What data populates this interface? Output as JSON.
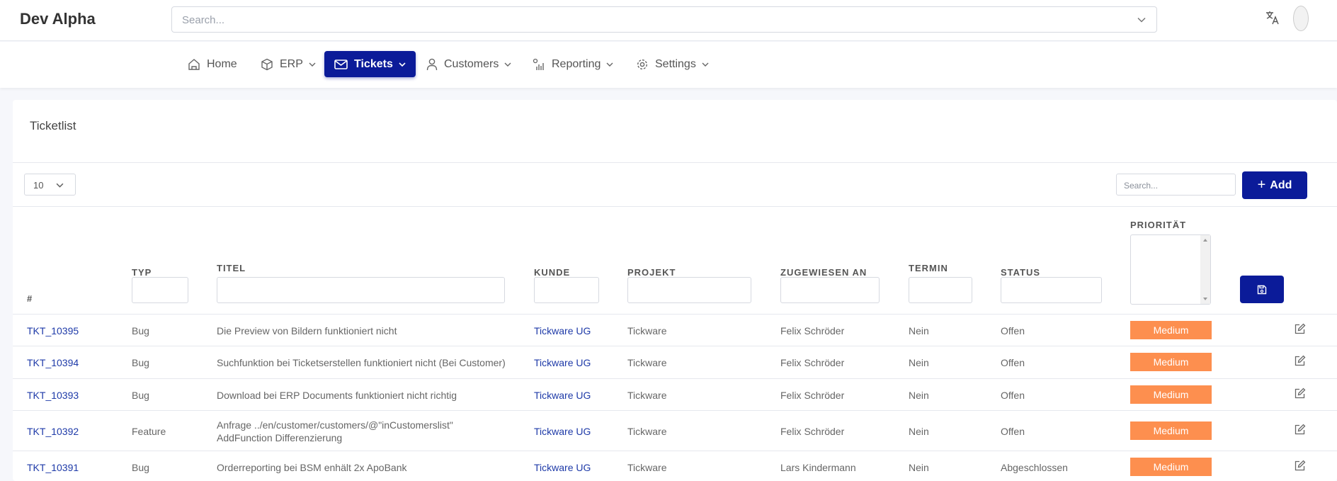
{
  "app": {
    "title": "Dev Alpha"
  },
  "global_search": {
    "placeholder": "Search..."
  },
  "nav": {
    "items": [
      {
        "label": "Home",
        "icon": "home-icon"
      },
      {
        "label": "ERP",
        "icon": "cube-icon"
      },
      {
        "label": "Tickets",
        "icon": "mail-icon",
        "active": true
      },
      {
        "label": "Customers",
        "icon": "user-icon"
      },
      {
        "label": "Reporting",
        "icon": "chart-icon"
      },
      {
        "label": "Settings",
        "icon": "gear-icon"
      }
    ]
  },
  "card": {
    "title": "Ticketlist",
    "page_size": "10",
    "search_placeholder": "Search...",
    "add_label": "Add"
  },
  "table": {
    "columns": [
      "#",
      "TYP",
      "TITEL",
      "KUNDE",
      "PROJEKT",
      "ZUGEWIESEN AN",
      "TERMIN",
      "STATUS",
      "PRIORITÄT"
    ],
    "rows": [
      {
        "id": "TKT_10395",
        "typ": "Bug",
        "titel": "Die Preview von Bildern funktioniert nicht",
        "titel2": "",
        "kunde": "Tickware UG",
        "projekt": "Tickware",
        "zugewiesen": "Felix Schröder",
        "termin": "Nein",
        "status": "Offen",
        "prioritaet": "Medium"
      },
      {
        "id": "TKT_10394",
        "typ": "Bug",
        "titel": "Suchfunktion bei Ticketserstellen funktioniert nicht (Bei Customer)",
        "titel2": "",
        "kunde": "Tickware UG",
        "projekt": "Tickware",
        "zugewiesen": "Felix Schröder",
        "termin": "Nein",
        "status": "Offen",
        "prioritaet": "Medium"
      },
      {
        "id": "TKT_10393",
        "typ": "Bug",
        "titel": "Download bei ERP Documents funktioniert nicht richtig",
        "titel2": "",
        "kunde": "Tickware UG",
        "projekt": "Tickware",
        "zugewiesen": "Felix Schröder",
        "termin": "Nein",
        "status": "Offen",
        "prioritaet": "Medium"
      },
      {
        "id": "TKT_10392",
        "typ": "Feature",
        "titel": "Anfrage ../en/customer/customers/@\"inCustomerslist\"",
        "titel2": "AddFunction Differenzierung",
        "kunde": "Tickware UG",
        "projekt": "Tickware",
        "zugewiesen": "Felix Schröder",
        "termin": "Nein",
        "status": "Offen",
        "prioritaet": "Medium"
      },
      {
        "id": "TKT_10391",
        "typ": "Bug",
        "titel": "Orderreporting bei BSM enhält 2x ApoBank",
        "titel2": "",
        "kunde": "Tickware UG",
        "projekt": "Tickware",
        "zugewiesen": "Lars Kindermann",
        "termin": "Nein",
        "status": "Abgeschlossen",
        "prioritaet": "Medium"
      }
    ]
  },
  "colors": {
    "primary": "#0b1b99",
    "link": "#1e3aa8",
    "priority_medium": "#fd8f4f"
  }
}
